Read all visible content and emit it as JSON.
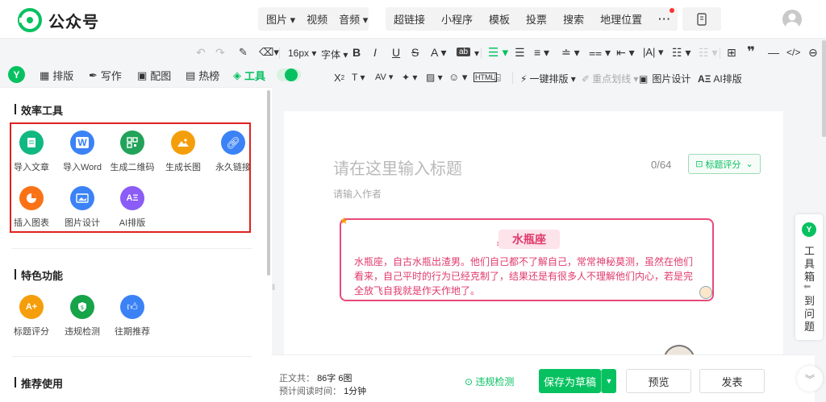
{
  "app": {
    "brand": "公众号"
  },
  "topnav": {
    "media": [
      "图片",
      "视频",
      "音频"
    ],
    "insert": [
      "超链接",
      "小程序",
      "模板",
      "投票",
      "搜索",
      "地理位置",
      "···"
    ]
  },
  "toolbar": {
    "font_size": "16px",
    "font": "字体",
    "one_click": "一键排版",
    "highlight": "重点划线",
    "image_design": "图片设计",
    "ai_layout": "AI排版"
  },
  "tabs": {
    "layout": "排版",
    "write": "写作",
    "image": "配图",
    "hot": "热榜",
    "tools": "工具"
  },
  "efficiency": {
    "title": "效率工具",
    "items": [
      {
        "label": "导入文章"
      },
      {
        "label": "导入Word"
      },
      {
        "label": "生成二维码"
      },
      {
        "label": "生成长图"
      },
      {
        "label": "永久链接"
      },
      {
        "label": "插入图表"
      },
      {
        "label": "图片设计"
      },
      {
        "label": "AI排版"
      }
    ]
  },
  "features": {
    "title": "特色功能",
    "items": [
      {
        "label": "标题评分"
      },
      {
        "label": "违规检测"
      },
      {
        "label": "往期推荐"
      }
    ]
  },
  "recommend": {
    "title": "推荐使用"
  },
  "editor": {
    "title_placeholder": "请在这里输入标题",
    "counter": "0/64",
    "score_btn": "标题评分",
    "author_placeholder": "请输入作者",
    "card_title": "水瓶座",
    "card_body": "水瓶座，自古水瓶出渣男。他们自己都不了解自己，常常神秘莫测，虽然在他们看来，自己平时的行为已经克制了，结果还是有很多人不理解他们内心，若是完全放飞自我就是作天作地了。"
  },
  "bottom": {
    "word_label": "正文共：",
    "word_value": "86字 6图",
    "read_label": "预计阅读时间：",
    "read_value": "1分钟",
    "check": "违规检测",
    "save": "保存为草稿",
    "preview": "预览",
    "publish": "发表"
  },
  "sidepanel": {
    "t1": "工",
    "t2": "具",
    "t3": "箱",
    "t4": "到",
    "t5": "问",
    "t6": "题"
  },
  "colors": {
    "brand": "#07c160",
    "danger": "#e02020",
    "card": "#e03a6c"
  }
}
